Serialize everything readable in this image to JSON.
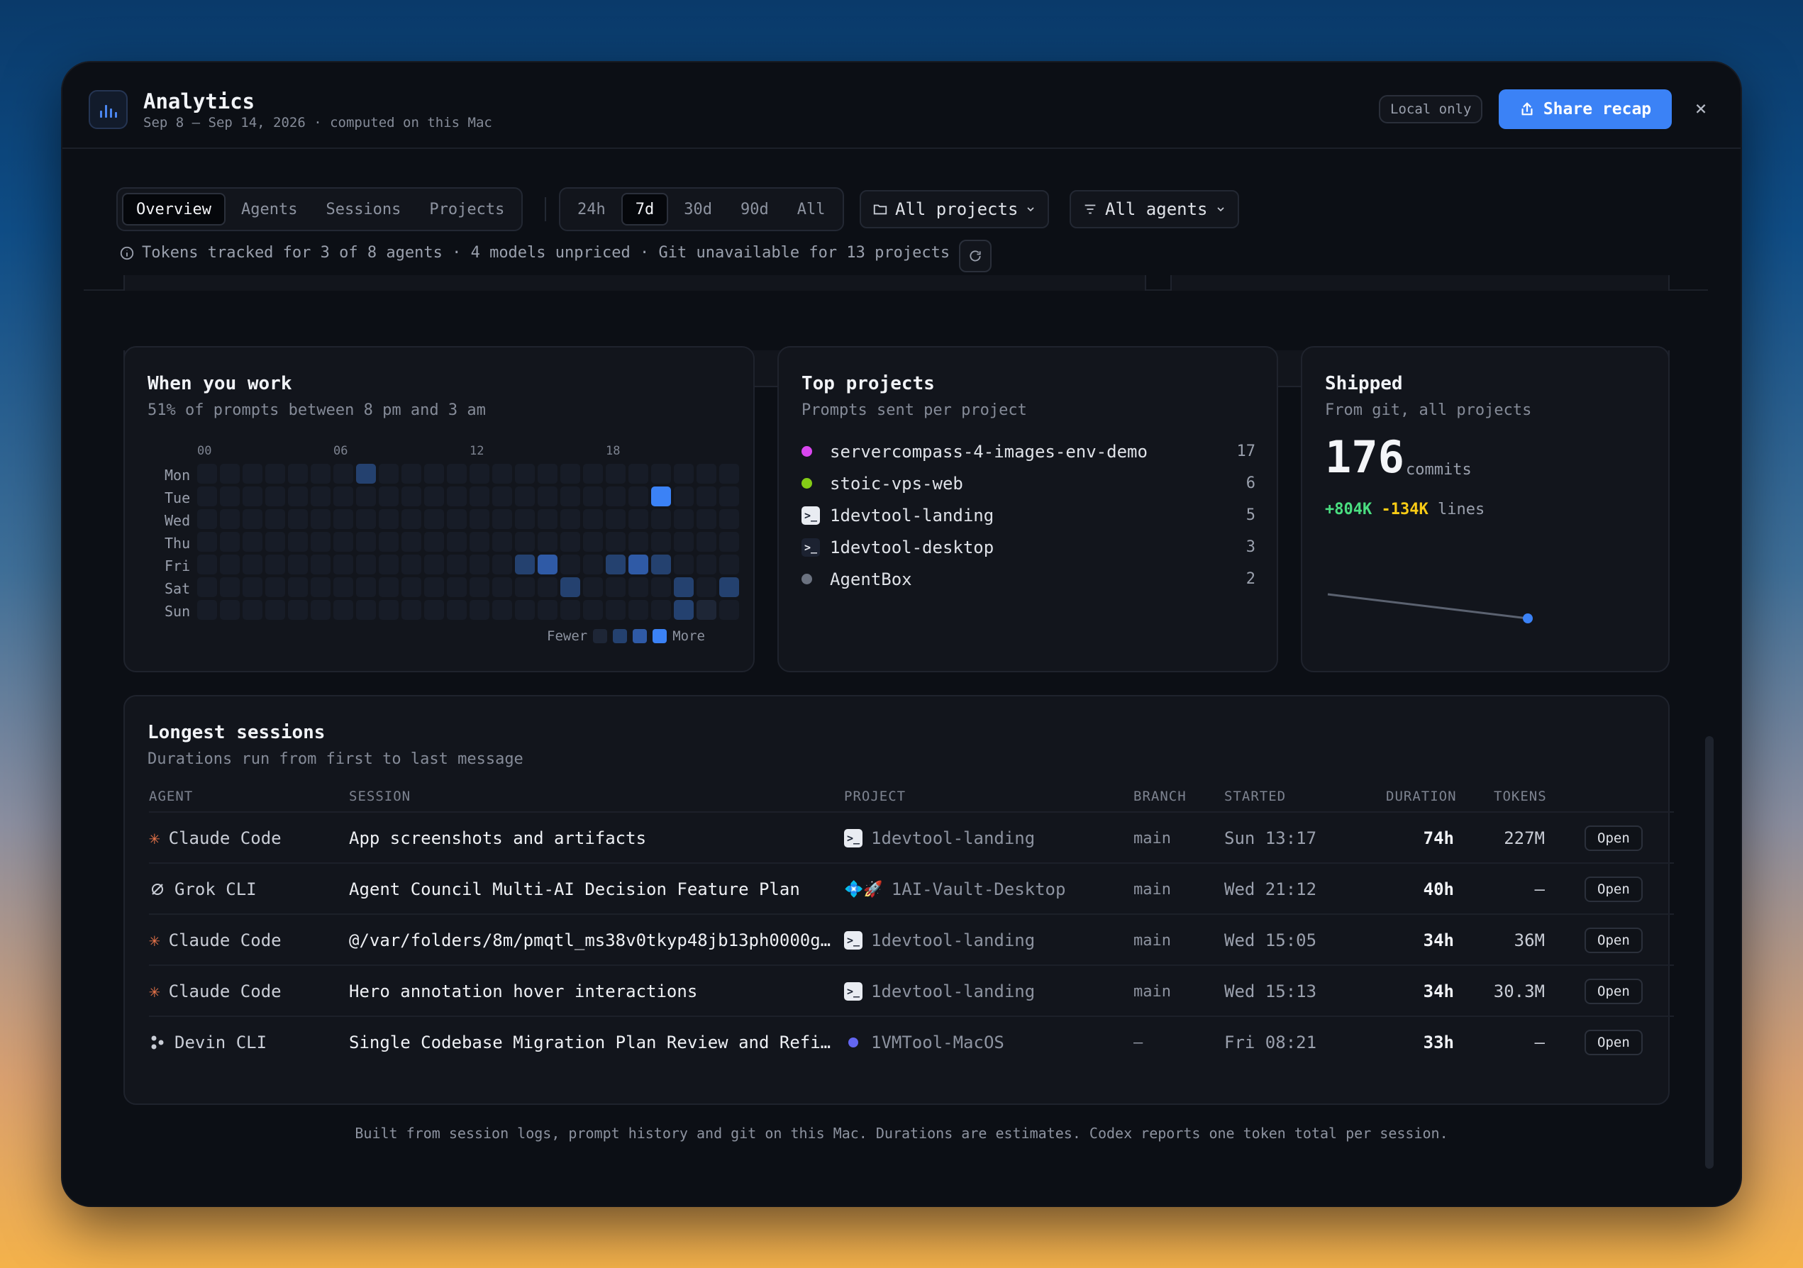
{
  "header": {
    "title": "Analytics",
    "subtitle": "Sep 8 – Sep 14, 2026 · computed on this Mac",
    "local_only": "Local only",
    "share_label": "Share recap",
    "close": "×"
  },
  "tabs": [
    {
      "label": "Overview",
      "active": true
    },
    {
      "label": "Agents",
      "active": false
    },
    {
      "label": "Sessions",
      "active": false
    },
    {
      "label": "Projects",
      "active": false
    }
  ],
  "ranges": [
    {
      "label": "24h",
      "active": false
    },
    {
      "label": "7d",
      "active": true
    },
    {
      "label": "30d",
      "active": false
    },
    {
      "label": "90d",
      "active": false
    },
    {
      "label": "All",
      "active": false
    }
  ],
  "filters": {
    "projects": "All projects",
    "agents": "All agents"
  },
  "info_line": "Tokens tracked for 3 of 8 agents · 4 models unpriced · Git unavailable for 13 projects",
  "when_you_work": {
    "title": "When you work",
    "subtitle": "51% of prompts between 8 pm and 3 am",
    "hours": [
      "00",
      "06",
      "12",
      "18"
    ],
    "days": [
      "Mon",
      "Tue",
      "Wed",
      "Thu",
      "Fri",
      "Sat",
      "Sun"
    ],
    "legend_fewer": "Fewer",
    "legend_more": "More",
    "active_cells": [
      {
        "day": 0,
        "hour": 7,
        "level": 2
      },
      {
        "day": 1,
        "hour": 20,
        "level": 4
      },
      {
        "day": 4,
        "hour": 14,
        "level": 2
      },
      {
        "day": 4,
        "hour": 15,
        "level": 3
      },
      {
        "day": 4,
        "hour": 18,
        "level": 2
      },
      {
        "day": 4,
        "hour": 19,
        "level": 3
      },
      {
        "day": 4,
        "hour": 20,
        "level": 2
      },
      {
        "day": 5,
        "hour": 16,
        "level": 2
      },
      {
        "day": 5,
        "hour": 21,
        "level": 2
      },
      {
        "day": 5,
        "hour": 23,
        "level": 2
      },
      {
        "day": 6,
        "hour": 21,
        "level": 2
      },
      {
        "day": 6,
        "hour": 22,
        "level": 1
      }
    ]
  },
  "top_projects": {
    "title": "Top projects",
    "subtitle": "Prompts sent per project",
    "items": [
      {
        "name": "servercompass-4-images-env-demo",
        "count": "17",
        "icon": "dot",
        "color": "#d946ef"
      },
      {
        "name": "stoic-vps-web",
        "count": "6",
        "icon": "dot",
        "color": "#84cc16"
      },
      {
        "name": "1devtool-landing",
        "count": "5",
        "icon": "app-light",
        "color": "#e9ecf2"
      },
      {
        "name": "1devtool-desktop",
        "count": "3",
        "icon": "app-dark",
        "color": "#1c2231"
      },
      {
        "name": "AgentBox",
        "count": "2",
        "icon": "dot",
        "color": "#6b7280"
      }
    ]
  },
  "shipped": {
    "title": "Shipped",
    "subtitle": "From git, all projects",
    "commits": "176",
    "commits_label": "commits",
    "added": "+804K",
    "removed": "-134K",
    "lines_label": "lines",
    "accent": "#3b82f6"
  },
  "sessions": {
    "title": "Longest sessions",
    "subtitle": "Durations run from first to last message",
    "columns": [
      "AGENT",
      "SESSION",
      "PROJECT",
      "BRANCH",
      "STARTED",
      "DURATION",
      "TOKENS"
    ],
    "open_label": "Open",
    "rows": [
      {
        "agent": "Claude Code",
        "agent_icon": "claude-icon",
        "session": "App screenshots and artifacts",
        "project": "1devtool-landing",
        "project_icon": "app-light",
        "branch": "main",
        "started": "Sun 13:17",
        "duration": "74h",
        "tokens": "227M"
      },
      {
        "agent": "Grok CLI",
        "agent_icon": "grok-icon",
        "session": "Agent Council Multi-AI Decision Feature Plan",
        "project": "1AI-Vault-Desktop",
        "project_icon": "vault",
        "branch": "main",
        "started": "Wed 21:12",
        "duration": "40h",
        "tokens": "—"
      },
      {
        "agent": "Claude Code",
        "agent_icon": "claude-icon",
        "session": "@/var/folders/8m/pmqtl_ms38v0tkyp48jb13ph0000g…",
        "project": "1devtool-landing",
        "project_icon": "app-light",
        "branch": "main",
        "started": "Wed 15:05",
        "duration": "34h",
        "tokens": "36M"
      },
      {
        "agent": "Claude Code",
        "agent_icon": "claude-icon",
        "session": "Hero annotation hover interactions",
        "project": "1devtool-landing",
        "project_icon": "app-light",
        "branch": "main",
        "started": "Wed 15:13",
        "duration": "34h",
        "tokens": "30.3M"
      },
      {
        "agent": "Devin CLI",
        "agent_icon": "devin-icon",
        "session": "Single Codebase Migration Plan Review and Refi…",
        "project": "1VMTool-MacOS",
        "project_icon": "dot",
        "branch": "—",
        "started": "Fri 08:21",
        "duration": "33h",
        "tokens": "—"
      }
    ]
  },
  "footer": "Built from session logs, prompt history and git on this Mac. Durations are estimates. Codex reports one token total per session."
}
